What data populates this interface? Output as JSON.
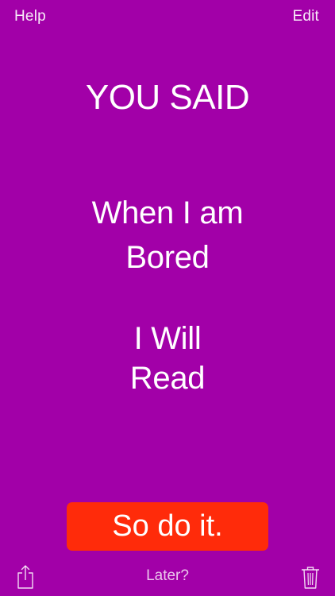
{
  "nav": {
    "help_label": "Help",
    "edit_label": "Edit"
  },
  "main": {
    "heading": "YOU SAID",
    "when_label": "When I am",
    "when_value": "Bored",
    "will_label": "I Will",
    "will_value": "Read"
  },
  "actions": {
    "primary_label": "So do it.",
    "later_label": "Later?"
  },
  "icons": {
    "share": "share-icon",
    "trash": "trash-icon"
  },
  "colors": {
    "background": "#a200a8",
    "primary_button": "#ff2b0a",
    "text": "#ffffff"
  }
}
